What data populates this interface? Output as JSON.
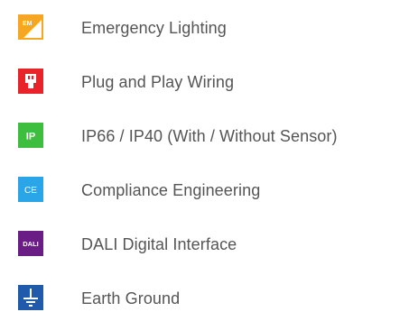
{
  "features": [
    {
      "label": "Emergency Lighting",
      "icon_name": "emergency-lighting-icon",
      "icon_text": "EM",
      "color": "#F5A623"
    },
    {
      "label": "Plug and Play Wiring",
      "icon_name": "plug-icon",
      "icon_text": "",
      "color": "#E8242B"
    },
    {
      "label": "IP66 / IP40 (With / Without Sensor)",
      "icon_name": "ip-rating-icon",
      "icon_text": "IP",
      "color": "#3DBE3F"
    },
    {
      "label": "Compliance Engineering",
      "icon_name": "ce-mark-icon",
      "icon_text": "CE",
      "color": "#2AA5E8"
    },
    {
      "label": "DALI Digital Interface",
      "icon_name": "dali-icon",
      "icon_text": "DALI",
      "color": "#6B1D86"
    },
    {
      "label": "Earth Ground",
      "icon_name": "earth-ground-icon",
      "icon_text": "",
      "color": "#1F5BAA"
    }
  ]
}
